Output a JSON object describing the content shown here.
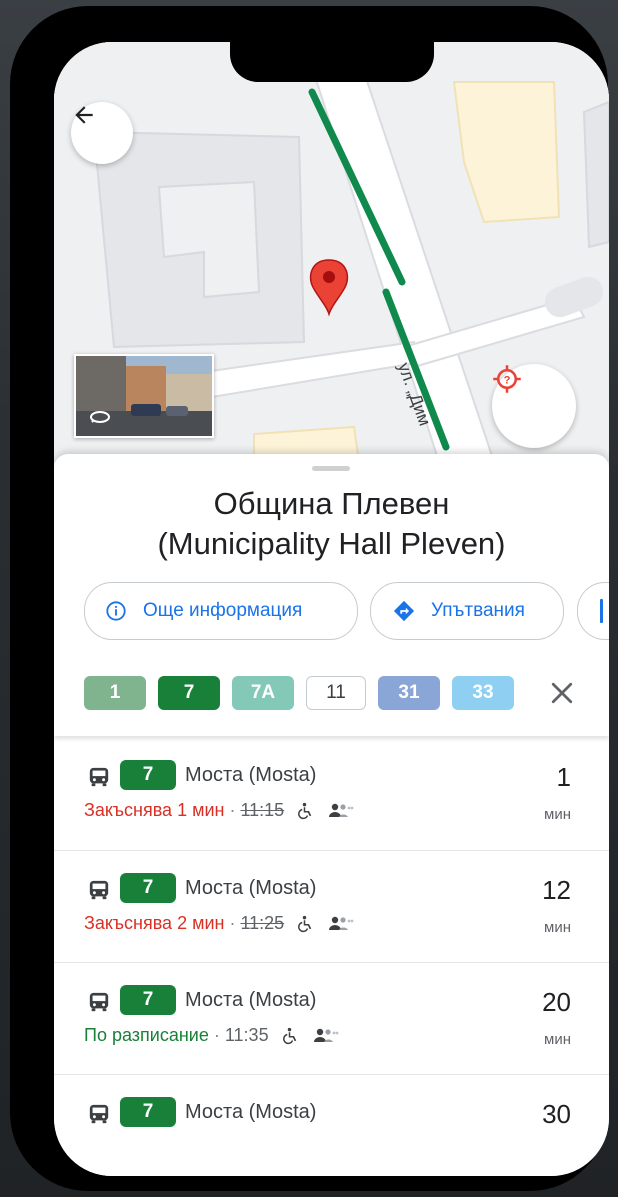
{
  "place": {
    "title_line1": "Община Плевен",
    "title_line2": "(Municipality Hall Pleven)"
  },
  "map": {
    "street_label": "ул. „Дим"
  },
  "actions": {
    "more_info": "Още информация",
    "directions": "Упътвания"
  },
  "routes": [
    {
      "label": "1",
      "color": "#7fb48e"
    },
    {
      "label": "7",
      "color": "#188038"
    },
    {
      "label": "7A",
      "color": "#84c9b7"
    },
    {
      "label": "11",
      "color": "#ffffff"
    },
    {
      "label": "31",
      "color": "#8aa6d6"
    },
    {
      "label": "33",
      "color": "#8fd0f2"
    }
  ],
  "departures": [
    {
      "route": "7",
      "destination": "Моста (Mosta)",
      "status": "Закъснява 1 мин",
      "status_type": "late",
      "scheduled": "11:15",
      "minutes": "1",
      "unit": "мин"
    },
    {
      "route": "7",
      "destination": "Моста (Mosta)",
      "status": "Закъснява 2 мин",
      "status_type": "late",
      "scheduled": "11:25",
      "minutes": "12",
      "unit": "мин"
    },
    {
      "route": "7",
      "destination": "Моста (Mosta)",
      "status": "По разписание",
      "status_type": "ontime",
      "scheduled": "11:35",
      "minutes": "20",
      "unit": "мин"
    },
    {
      "route": "7",
      "destination": "Моста (Mosta)",
      "status": "",
      "status_type": "",
      "scheduled": "",
      "minutes": "30",
      "unit": ""
    }
  ],
  "separator": "·",
  "colors": {
    "accent": "#1a73e8",
    "late": "#d93025",
    "ontime": "#188038",
    "transit_line": "#0f8a4c"
  }
}
